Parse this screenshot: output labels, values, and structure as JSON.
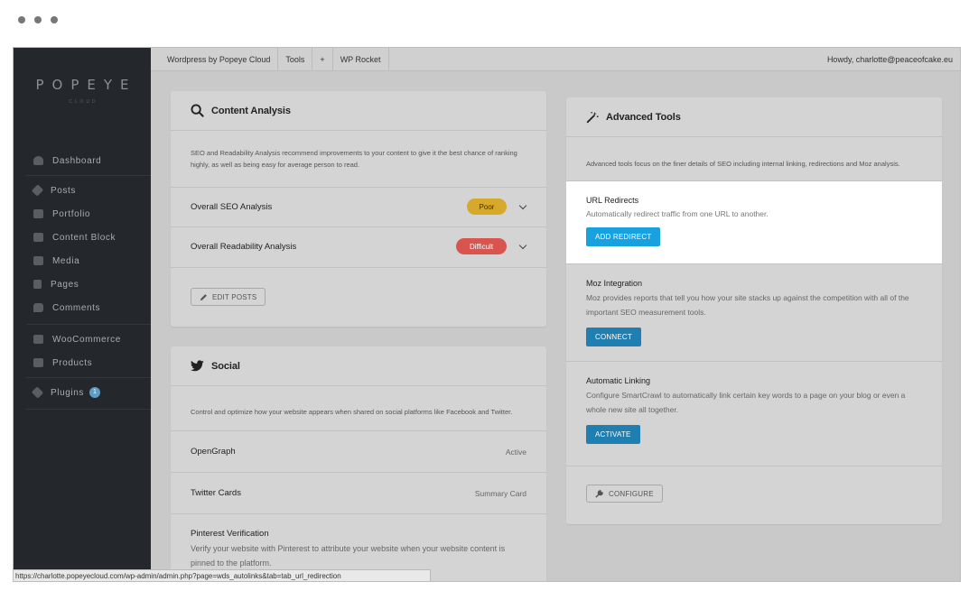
{
  "brand": {
    "logo": "POPEYE",
    "sub": "CLOUD"
  },
  "sidebar": {
    "items": [
      {
        "label": "Dashboard",
        "icon": "dashboard-icon"
      },
      {
        "label": "Posts",
        "icon": "pin-icon"
      },
      {
        "label": "Portfolio",
        "icon": "grid-icon"
      },
      {
        "label": "Content Block",
        "icon": "block-icon"
      },
      {
        "label": "Media",
        "icon": "media-icon"
      },
      {
        "label": "Pages",
        "icon": "page-icon"
      },
      {
        "label": "Comments",
        "icon": "comment-icon"
      },
      {
        "label": "WooCommerce",
        "icon": "woo-icon"
      },
      {
        "label": "Products",
        "icon": "box-icon"
      },
      {
        "label": "Plugins",
        "icon": "plug-icon",
        "badge": "1"
      }
    ]
  },
  "topbar": {
    "items": [
      "Wordpress by Popeye Cloud",
      "Tools",
      "+",
      "WP Rocket"
    ],
    "greeting": "Howdy, charlotte@peaceofcake.eu"
  },
  "content_analysis": {
    "title": "Content Analysis",
    "description": "SEO and Readability Analysis recommend improvements to your content to give it the best chance of ranking highly, as well as being easy for average person to read.",
    "rows": [
      {
        "label": "Overall SEO Analysis",
        "status": "Poor",
        "color": "#d7a92b"
      },
      {
        "label": "Overall Readability Analysis",
        "status": "Difficult",
        "color": "#d9534f"
      }
    ],
    "button": "EDIT POSTS"
  },
  "social": {
    "title": "Social",
    "description": "Control and optimize how your website appears when shared on social platforms like Facebook and Twitter.",
    "rows": [
      {
        "label": "OpenGraph",
        "value": "Active"
      },
      {
        "label": "Twitter Cards",
        "value": "Summary Card"
      }
    ],
    "pinterest": {
      "title": "Pinterest Verification",
      "description": "Verify your website with Pinterest to attribute your website when your website content is pinned to the platform."
    }
  },
  "advanced_tools": {
    "title": "Advanced Tools",
    "description": "Advanced tools focus on the finer details of SEO including internal linking, redirections and Moz analysis.",
    "redirects": {
      "title": "URL Redirects",
      "description": "Automatically redirect traffic from one URL to another.",
      "button": "ADD REDIRECT"
    },
    "moz": {
      "title": "Moz Integration",
      "description": "Moz provides reports that tell you how your site stacks up against the competition with all of the important SEO measurement tools.",
      "button": "CONNECT"
    },
    "autolink": {
      "title": "Automatic Linking",
      "description": "Configure SmartCrawl to automatically link certain key words to a page on your blog or even a whole new site all together.",
      "button": "ACTIVATE"
    },
    "configure": "CONFIGURE"
  },
  "status_url": "https://charlotte.popeyecloud.com/wp-admin/admin.php?page=wds_autolinks&tab=tab_url_redirection"
}
